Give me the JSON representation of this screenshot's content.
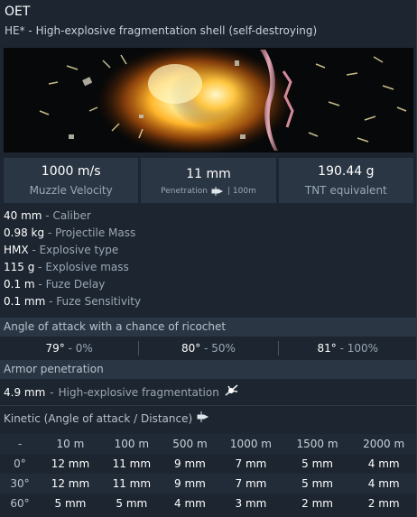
{
  "header": {
    "title": "OET",
    "subtitle": "HE* - High-explosive fragmentation shell (self-destroying)"
  },
  "stats": {
    "velocity_value": "1000 m/s",
    "velocity_label": "Muzzle Velocity",
    "penetration_value": "11 mm",
    "penetration_label": "Penetration",
    "penetration_distance": "| 100m",
    "tnt_value": "190.44 g",
    "tnt_label": "TNT equivalent"
  },
  "properties": [
    {
      "value": "40 mm",
      "label": "Caliber"
    },
    {
      "value": "0.98 kg",
      "label": "Projectile Mass"
    },
    {
      "value": "HMX",
      "label": "Explosive type"
    },
    {
      "value": "115 g",
      "label": "Explosive mass"
    },
    {
      "value": "0.1 m",
      "label": "Fuze Delay"
    },
    {
      "value": "0.1 mm",
      "label": "Fuze Sensitivity"
    }
  ],
  "ricochet": {
    "title": "Angle of attack with a chance of ricochet",
    "items": [
      {
        "angle": "79°",
        "chance": "0%"
      },
      {
        "angle": "80°",
        "chance": "50%"
      },
      {
        "angle": "81°",
        "chance": "100%"
      }
    ]
  },
  "armor": {
    "title": "Armor penetration",
    "he_value": "4.9 mm",
    "he_label": "High-explosive fragmentation",
    "kinetic_title": "Kinetic (Angle of attack / Distance)"
  },
  "kinetic_table": {
    "corner": "-",
    "distances": [
      "10 m",
      "100 m",
      "500 m",
      "1000 m",
      "1500 m",
      "2000 m"
    ],
    "rows": [
      {
        "angle": "0°",
        "values": [
          "12 mm",
          "11 mm",
          "9 mm",
          "7 mm",
          "5 mm",
          "4 mm"
        ]
      },
      {
        "angle": "30°",
        "values": [
          "12 mm",
          "11 mm",
          "9 mm",
          "7 mm",
          "5 mm",
          "4 mm"
        ]
      },
      {
        "angle": "60°",
        "values": [
          "5 mm",
          "5 mm",
          "4 mm",
          "3 mm",
          "2 mm",
          "2 mm"
        ]
      }
    ]
  },
  "colors": {
    "background": "#1c2530",
    "panel": "#2a3643",
    "label_gray": "#9aa8b5"
  }
}
